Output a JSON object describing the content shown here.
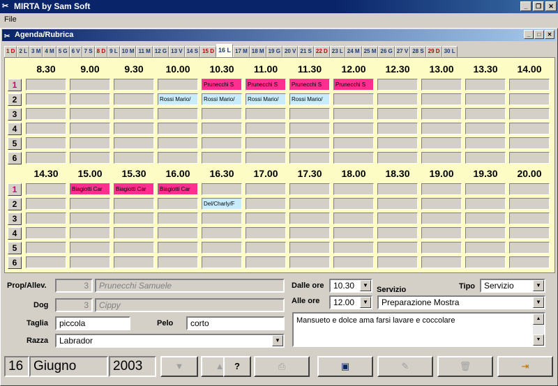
{
  "app": {
    "title": "MIRTA by Sam Soft",
    "menu_file": "File"
  },
  "window": {
    "title": "Agenda/Rubrica"
  },
  "tabs": [
    {
      "label": "1 D",
      "weekend": true
    },
    {
      "label": "2 L"
    },
    {
      "label": "3 M"
    },
    {
      "label": "4 M"
    },
    {
      "label": "5 G"
    },
    {
      "label": "6 V"
    },
    {
      "label": "7 S"
    },
    {
      "label": "8 D",
      "weekend": true
    },
    {
      "label": "9 L"
    },
    {
      "label": "10 M"
    },
    {
      "label": "11 M"
    },
    {
      "label": "12 G"
    },
    {
      "label": "13 V"
    },
    {
      "label": "14 S"
    },
    {
      "label": "15 D",
      "weekend": true
    },
    {
      "label": "16 L",
      "selected": true
    },
    {
      "label": "17 M"
    },
    {
      "label": "18 M"
    },
    {
      "label": "19 G"
    },
    {
      "label": "20 V"
    },
    {
      "label": "21 S"
    },
    {
      "label": "22 D",
      "weekend": true
    },
    {
      "label": "23 L"
    },
    {
      "label": "24 M"
    },
    {
      "label": "25 M"
    },
    {
      "label": "26 G"
    },
    {
      "label": "27 V"
    },
    {
      "label": "28 S"
    },
    {
      "label": "29 D",
      "weekend": true
    },
    {
      "label": "30 L"
    }
  ],
  "agenda": {
    "top_times": [
      "8.30",
      "9.00",
      "9.30",
      "10.00",
      "10.30",
      "11.00",
      "11.30",
      "12.00",
      "12.30",
      "13.00",
      "13.30",
      "14.00"
    ],
    "bottom_times": [
      "14.30",
      "15.00",
      "15.30",
      "16.00",
      "16.30",
      "17.00",
      "17.30",
      "18.00",
      "18.30",
      "19.00",
      "19.30",
      "20.00"
    ],
    "row_labels": [
      "1",
      "2",
      "3",
      "4",
      "5",
      "6"
    ],
    "top_entries": [
      {
        "row": 0,
        "col": 4,
        "text": "Prunecchi S",
        "color": "pink"
      },
      {
        "row": 0,
        "col": 5,
        "text": "Prunecchi S",
        "color": "pink"
      },
      {
        "row": 0,
        "col": 6,
        "text": "Prunecchi S",
        "color": "pink"
      },
      {
        "row": 0,
        "col": 7,
        "text": "Prunecchi S",
        "color": "pink"
      },
      {
        "row": 1,
        "col": 3,
        "text": "Rossi Mario/",
        "color": "blue"
      },
      {
        "row": 1,
        "col": 4,
        "text": "Rossi Mario/",
        "color": "blue"
      },
      {
        "row": 1,
        "col": 5,
        "text": "Rossi Mario/",
        "color": "blue"
      },
      {
        "row": 1,
        "col": 6,
        "text": "Rossi Mario/",
        "color": "blue"
      }
    ],
    "bottom_entries": [
      {
        "row": 0,
        "col": 1,
        "text": "Biagiotti Car",
        "color": "pink"
      },
      {
        "row": 0,
        "col": 2,
        "text": "Biagiotti Car",
        "color": "pink"
      },
      {
        "row": 0,
        "col": 3,
        "text": "Biagiotti Car",
        "color": "pink"
      },
      {
        "row": 1,
        "col": 4,
        "text": "Del/Charly/F",
        "color": "blue"
      }
    ]
  },
  "form": {
    "prop_label": "Prop/Allev.",
    "prop_id": "3",
    "prop_name": "Prunecchi Samuele",
    "dog_label": "Dog",
    "dog_id": "3",
    "dog_name": "Cippy",
    "taglia_label": "Taglia",
    "taglia_value": "piccola",
    "pelo_label": "Pelo",
    "pelo_value": "corto",
    "razza_label": "Razza",
    "razza_value": "Labrador",
    "dalle_label": "Dalle ore",
    "dalle_value": "10.30",
    "alle_label": "Alle ore",
    "alle_value": "12.00",
    "servizio_label": "Servizio",
    "servizio_value": "Preparazione Mostra",
    "tipo_label": "Tipo",
    "tipo_value": "Servizio",
    "note": "Mansueto e dolce ama farsi lavare e coccolare"
  },
  "footer": {
    "day": "16",
    "month": "Giugno",
    "year": "2003"
  },
  "colors": {
    "pink": "#ff2f8f",
    "blue": "#c8ecfc",
    "panel": "#fcfcc4"
  }
}
